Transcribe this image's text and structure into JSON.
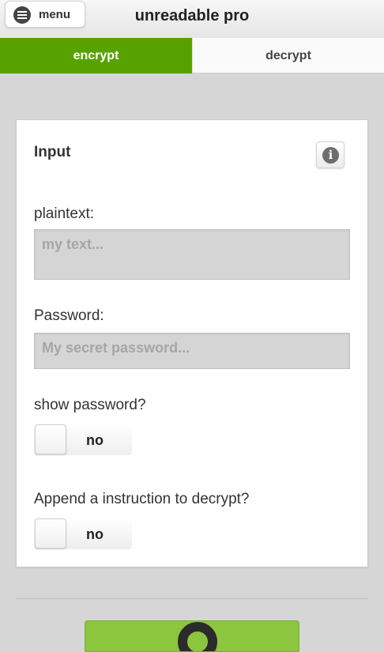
{
  "header": {
    "menu_label": "menu",
    "title": "unreadable pro"
  },
  "tabs": [
    {
      "label": "encrypt",
      "active": true
    },
    {
      "label": "decrypt",
      "active": false
    }
  ],
  "card": {
    "title": "Input",
    "plaintext": {
      "label": "plaintext:",
      "placeholder": "my text...",
      "value": ""
    },
    "password": {
      "label": "Password:",
      "placeholder": "My secret password...",
      "value": ""
    },
    "show_password": {
      "label": "show password?",
      "state": "no"
    },
    "append_instruction": {
      "label": "Append a instruction to decrypt?",
      "state": "no"
    }
  },
  "colors": {
    "accent": "#58a200",
    "action_button": "#8cc63f",
    "background": "#d6d6d6"
  },
  "icons": {
    "menu": "menu-icon",
    "info": "info-icon",
    "action": "lock-icon"
  }
}
